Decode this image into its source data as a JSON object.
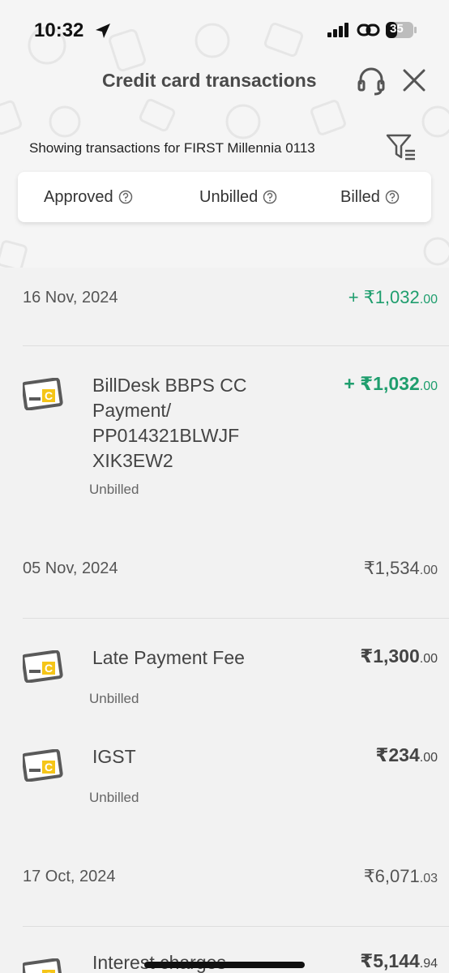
{
  "status_bar": {
    "time": "10:32",
    "battery": "35"
  },
  "header": {
    "title": "Credit card transactions",
    "showing_text": "Showing transactions for FIRST Millennia 0113"
  },
  "tabs": [
    {
      "label": "Approved"
    },
    {
      "label": "Unbilled"
    },
    {
      "label": "Billed"
    }
  ],
  "groups": [
    {
      "date": "16 Nov, 2024",
      "amount_main": "+ ₹1,032",
      "amount_dec": ".00",
      "credit": true,
      "transactions": [
        {
          "description": "BillDesk BBPS CC Payment/ PP014321BLWJF XIK3EW2",
          "amount_main": "+ ₹1,032",
          "amount_dec": ".00",
          "status": "Unbilled"
        }
      ]
    },
    {
      "date": "05 Nov, 2024",
      "amount_main": "₹1,534",
      "amount_dec": ".00",
      "credit": false,
      "transactions": [
        {
          "description": "Late Payment Fee",
          "amount_main": "₹1,300",
          "amount_dec": ".00",
          "status": "Unbilled"
        },
        {
          "description": "IGST",
          "amount_main": "₹234",
          "amount_dec": ".00",
          "status": "Unbilled"
        }
      ]
    },
    {
      "date": "17 Oct, 2024",
      "amount_main": "₹6,071",
      "amount_dec": ".03",
      "credit": false,
      "transactions": [
        {
          "description": "Interest charges",
          "amount_main": "₹5,144",
          "amount_dec": ".94",
          "status": ""
        }
      ]
    }
  ],
  "colors": {
    "credit_green": "#1f9e6e",
    "card_icon_yellow": "#f5c518",
    "card_icon_gray": "#5a5a5a"
  }
}
